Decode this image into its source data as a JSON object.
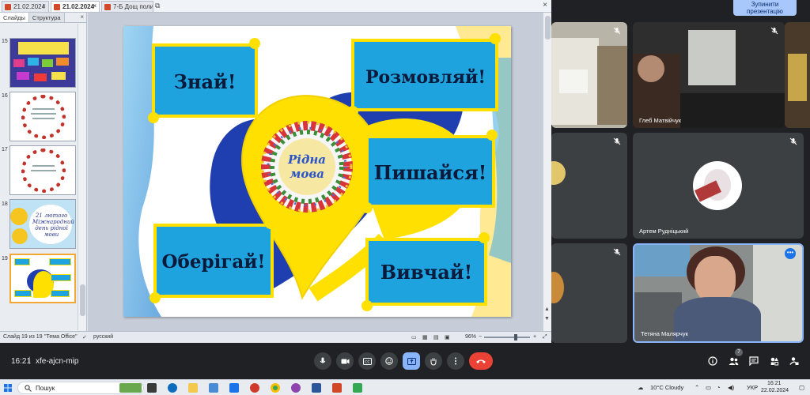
{
  "browser_tabs": [
    {
      "label": "21.02.2024",
      "active": false
    },
    {
      "label": "21.02.2024",
      "active": true
    },
    {
      "label": "7-Б Дощ полив",
      "active": false
    }
  ],
  "side_panel": {
    "tab_slides": "Слайды",
    "tab_outline": "Структура",
    "close": "×"
  },
  "thumbnails": [
    {
      "num": "15",
      "caption": ""
    },
    {
      "num": "16",
      "caption": ""
    },
    {
      "num": "17",
      "caption": ""
    },
    {
      "num": "18",
      "caption": "21 лютого Міжнародний день рідної мови"
    },
    {
      "num": "19",
      "caption": ""
    }
  ],
  "slide": {
    "banners": [
      "Знай!",
      "Розмовляй!",
      "Пишайся!",
      "Оберігай!",
      "Вивчай!"
    ],
    "wreath_text_1": "Рідна",
    "wreath_text_2": "мова"
  },
  "status_bar": {
    "slide_count": "Слайд 19 из 19",
    "theme": "\"Тема Office\"",
    "language": "русский",
    "zoom": "96%"
  },
  "meet": {
    "stop_presenting": "Зупинити презентацію",
    "participants": [
      {
        "name": "",
        "muted": true
      },
      {
        "name": "Глеб Матвійчук",
        "muted": true
      },
      {
        "name": "",
        "muted": true
      },
      {
        "name": "Артем Рудніцький",
        "muted": true
      },
      {
        "name": "",
        "muted": true
      },
      {
        "name": "Тетяна Малярчук",
        "muted": false
      }
    ],
    "time": "16:21",
    "separator": "|",
    "meeting_code": "xfe-ajcn-mip",
    "participant_badge": "7"
  },
  "taskbar": {
    "search_placeholder": "Пошук",
    "weather": "10°C  Cloudy",
    "language": "УКР",
    "clock_time": "16:21",
    "clock_date": "22.02.2024"
  },
  "colors": {
    "slide_blue": "#1fa3df",
    "slide_yellow": "#ffe000",
    "heart_blue": "#1f3fb0",
    "meet_bg": "#202124",
    "end_call": "#ea4335",
    "present_highlight": "#8ab4f8"
  }
}
